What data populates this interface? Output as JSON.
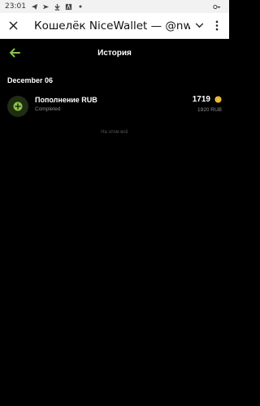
{
  "status_bar": {
    "time": "23:01",
    "icons": [
      "telegram-icon",
      "send-icon",
      "download-icon",
      "a-icon",
      "dot-icon"
    ],
    "right_icons": [
      "key-icon"
    ]
  },
  "app_header": {
    "title": "Кошелёк NiceWallet — @nwallet",
    "icons": [
      "close-icon",
      "chevron-down-icon",
      "more-vertical-icon"
    ]
  },
  "page": {
    "title": "История",
    "back_icon": "arrow-left-icon",
    "accent_color": "#8bc34a"
  },
  "history": {
    "groups": [
      {
        "date": "December 06",
        "items": [
          {
            "title": "Пополнение RUB",
            "status": "Completed",
            "amount": "1719",
            "fiat": "1920 RUB",
            "icon": "plus-circle-icon",
            "coin_icon": "coin-icon",
            "coin_color": "#f5c542"
          }
        ]
      }
    ],
    "end_text": "На этом всё"
  }
}
